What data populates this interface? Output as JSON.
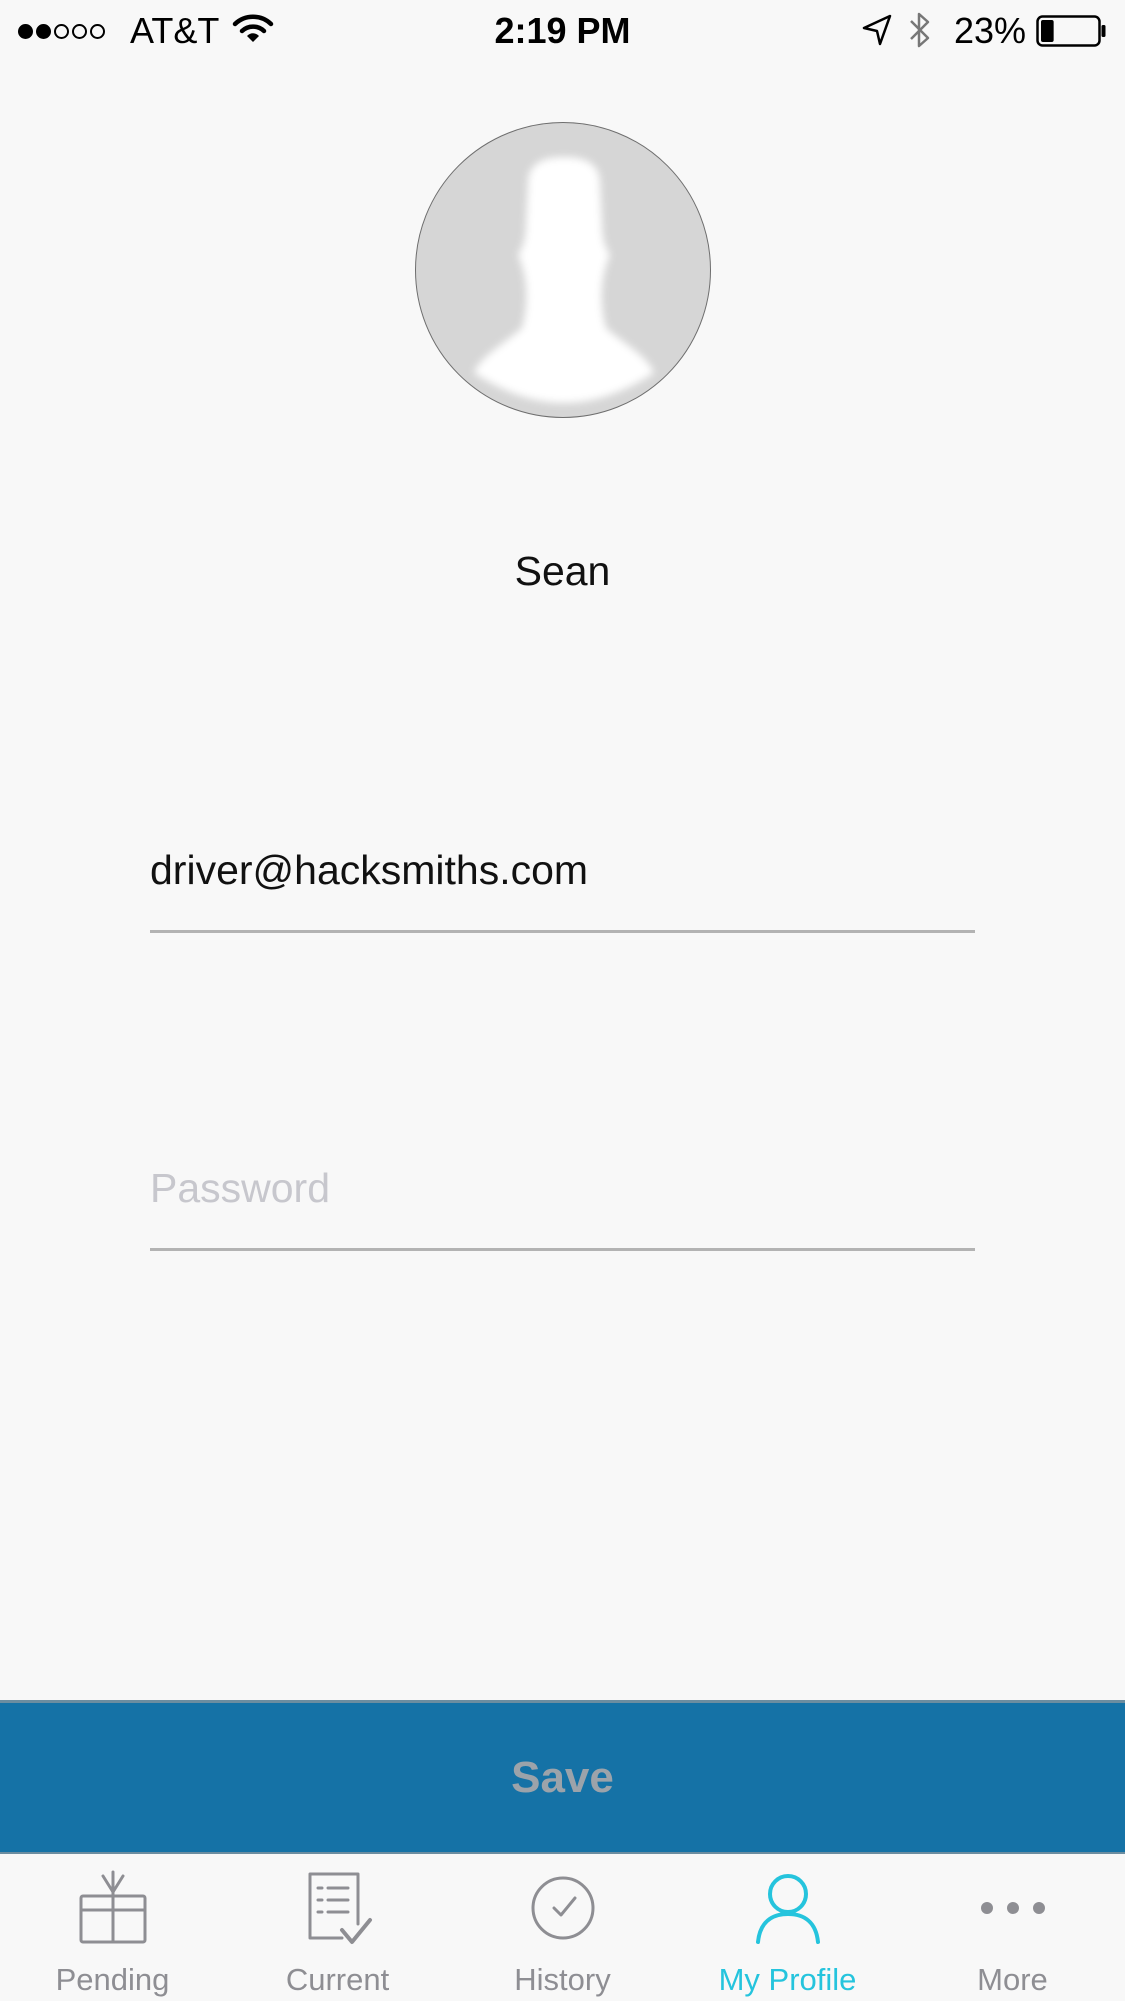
{
  "status_bar": {
    "signal_bars_filled": 2,
    "signal_bars_total": 5,
    "carrier": "AT&T",
    "time": "2:19 PM",
    "battery_percent_label": "23%",
    "battery_level": 0.23,
    "icons": [
      "wifi-icon",
      "location-arrow-icon",
      "bluetooth-icon",
      "battery-icon"
    ]
  },
  "profile": {
    "avatar_icon": "default-avatar-silhouette",
    "name": "Sean"
  },
  "form": {
    "email_value": "driver@hacksmiths.com",
    "password_value": "",
    "password_placeholder": "Password"
  },
  "save_button": {
    "label": "Save",
    "background": "#1572a6",
    "label_color": "#9ca3aa"
  },
  "tab_bar": {
    "active_color": "#25c4dd",
    "inactive_color": "#8e8e93",
    "tabs": [
      {
        "label": "Pending",
        "icon": "gift-icon",
        "active": false
      },
      {
        "label": "Current",
        "icon": "checklist-icon",
        "active": false
      },
      {
        "label": "History",
        "icon": "clock-check-icon",
        "active": false
      },
      {
        "label": "My Profile",
        "icon": "person-icon",
        "active": true
      },
      {
        "label": "More",
        "icon": "more-dots-icon",
        "active": false
      }
    ]
  }
}
